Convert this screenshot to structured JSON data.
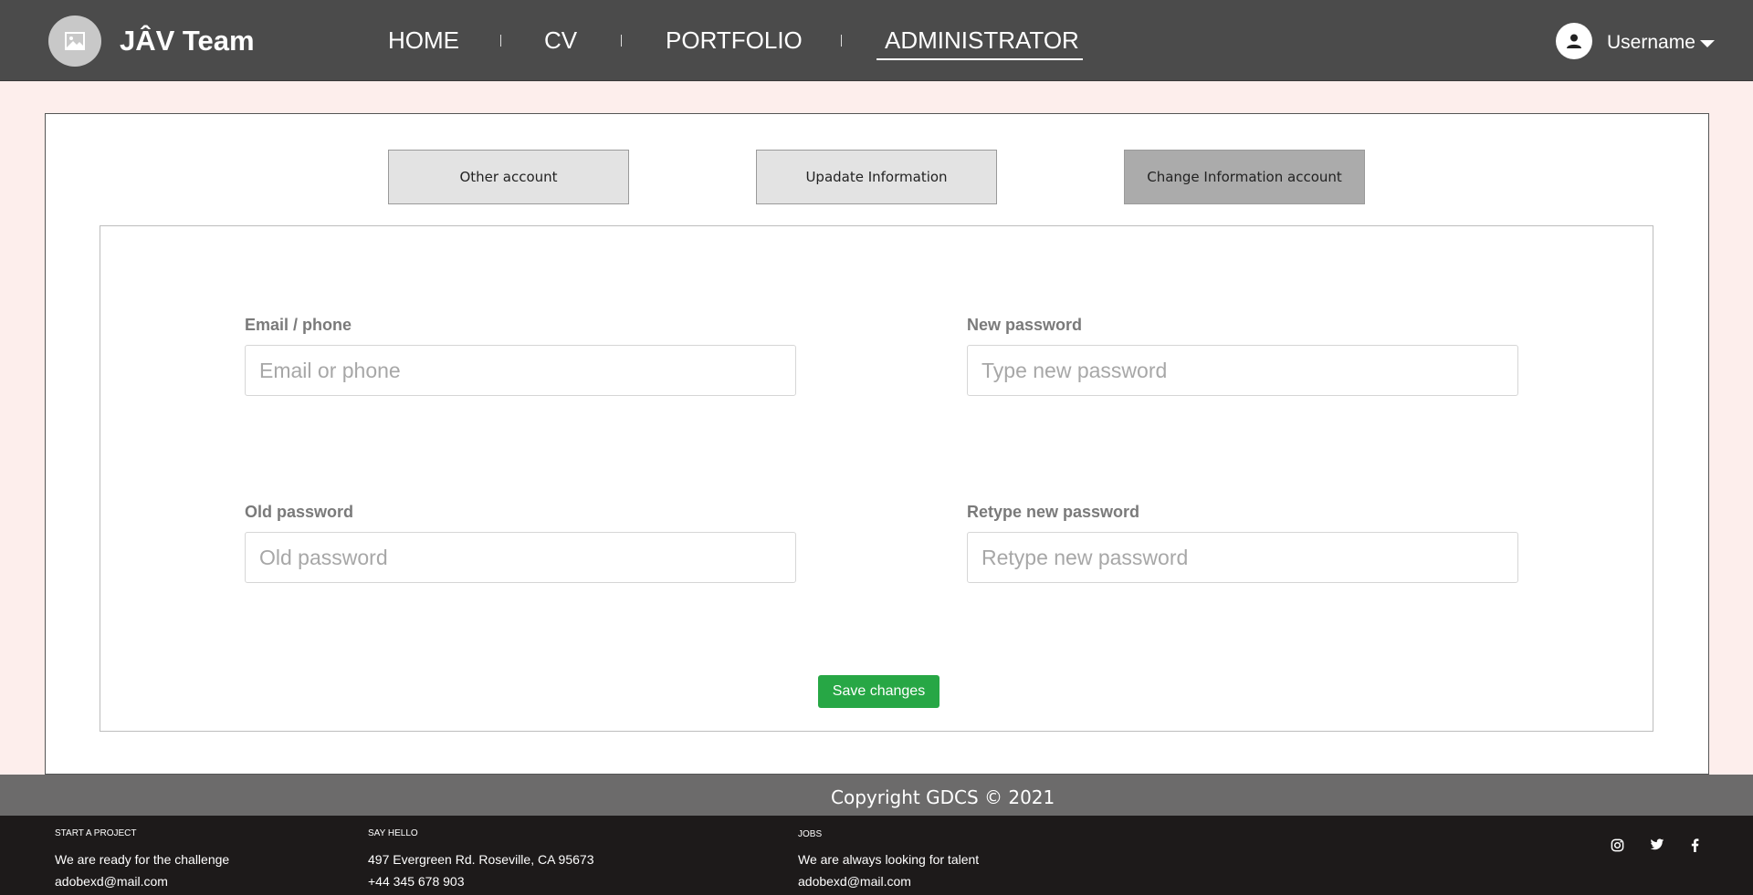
{
  "header": {
    "brand": "JÂV Team",
    "nav": [
      {
        "label": "HOME"
      },
      {
        "label": "CV"
      },
      {
        "label": "PORTFOLIO"
      },
      {
        "label": "ADMINISTRATOR",
        "active": true
      }
    ],
    "username": "Username",
    "icons": {
      "logo": "image-icon",
      "user": "user-icon",
      "caret": "caret-down-icon"
    },
    "background_color": "#4b4b4b"
  },
  "tabs": [
    {
      "label": "Other account",
      "active": false
    },
    {
      "label": "Upadate Information",
      "active": false
    },
    {
      "label": "Change Information account",
      "active": true
    }
  ],
  "form": {
    "email": {
      "label": "Email / phone",
      "placeholder": "Email or phone"
    },
    "new_password": {
      "label": "New password",
      "placeholder": "Type new password"
    },
    "old_password": {
      "label": "Old password",
      "placeholder": "Old password"
    },
    "retype_password": {
      "label": "Retype new password",
      "placeholder": "Retype new password"
    },
    "save_label": "Save changes",
    "save_color": "#27a745"
  },
  "copyright": "Copyright GDCS © 2021",
  "footer": {
    "start": {
      "heading": "START A PROJECT",
      "line1": "We are ready for the challenge",
      "line2": "adobexd@mail.com"
    },
    "hello": {
      "heading": "SAY HELLO",
      "line1": "497 Evergreen Rd. Roseville, CA 95673",
      "line2": "+44 345 678 903"
    },
    "jobs": {
      "heading": "JOBS",
      "line1": "We are always looking for talent",
      "line2": "adobexd@mail.com"
    },
    "social_icons": [
      "instagram-icon",
      "twitter-icon",
      "facebook-icon"
    ]
  }
}
